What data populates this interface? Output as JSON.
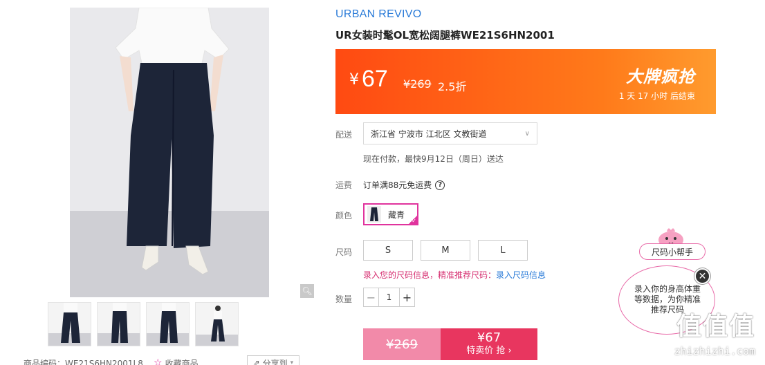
{
  "gallery": {
    "zoom_icon": "magnifier-icon",
    "thumb_count": 4
  },
  "product_info": {
    "code_label": "商品编码：",
    "code_value": "WE21S6HN2001L8",
    "favorite_label": "收藏商品",
    "share_label": "分享到"
  },
  "brand": "URBAN REVIVO",
  "title": "UR女装时髦OL宽松阔腿裤WE21S6HN2001",
  "price": {
    "currency": "¥",
    "current": "67",
    "original": "¥269",
    "discount": "2.5折",
    "promo": "大牌疯抢",
    "countdown": "1 天 17 小时 后结束"
  },
  "delivery": {
    "label": "配送",
    "address": "浙江省 宁波市 江北区 文教街道",
    "note": "现在付款，最快9月12日（周日）送达"
  },
  "shipping": {
    "label": "运费",
    "text": "订单满88元免运费"
  },
  "color": {
    "label": "颜色",
    "selected": "藏青"
  },
  "size": {
    "label": "尺码",
    "options": [
      "S",
      "M",
      "L"
    ],
    "note_prefix": "录入您的尺码信息，精准推荐尺码：",
    "note_link": "录入尺码信息"
  },
  "quantity": {
    "label": "数量",
    "value": "1"
  },
  "buy": {
    "original": "¥269",
    "price": "¥67",
    "action": "特卖价 抢 ›"
  },
  "size_helper": {
    "tag": "尺码小帮手",
    "bubble": "录入你的身高体重等数据，为你精准推荐尺码"
  },
  "watermark": {
    "logo": "值值值",
    "url": "zhizhizhi.com"
  },
  "colors": {
    "accent_blue": "#2a7bd8",
    "promo_orange": "#ff5a14",
    "select_pink": "#e0339d",
    "buy_red": "#e8365f"
  }
}
